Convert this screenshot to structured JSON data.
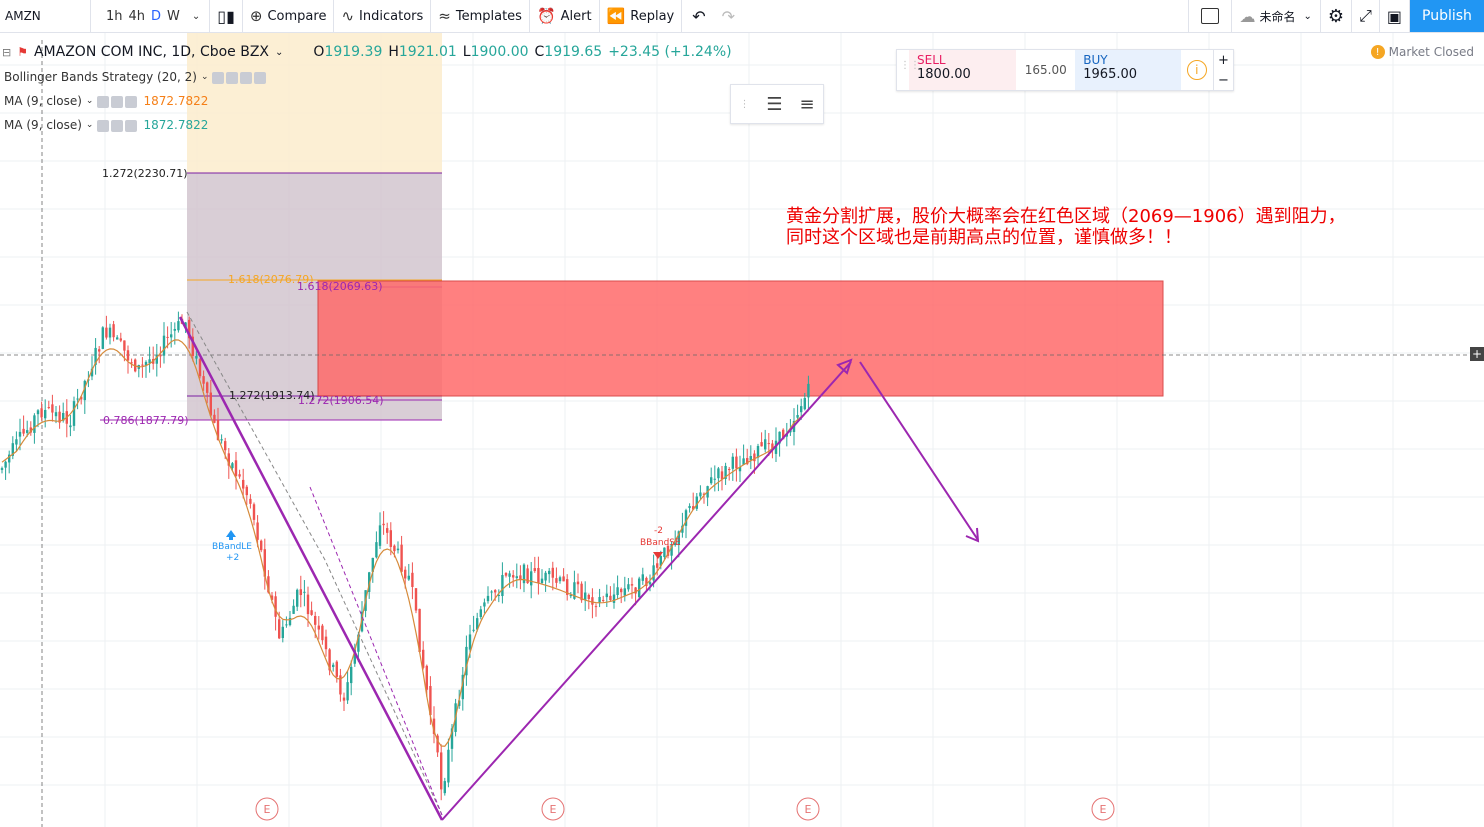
{
  "toolbar": {
    "symbol": "AMZN",
    "intervals": [
      "1h",
      "4h",
      "D",
      "W"
    ],
    "compare": "Compare",
    "indicators": "Indicators",
    "templates": "Templates",
    "alert": "Alert",
    "replay": "Replay",
    "layout_name": "未命名",
    "publish": "Publish"
  },
  "legend": {
    "title": "AMAZON COM INC, 1D, Cboe BZX",
    "o_label": "O",
    "o": "1919.39",
    "h_label": "H",
    "h": "1921.01",
    "l_label": "L",
    "l": "1900.00",
    "c_label": "C",
    "c": "1919.65",
    "change": "+23.45 (+1.24%)"
  },
  "indicators": [
    {
      "name": "Bollinger Bands Strategy (20, 2)",
      "value": "",
      "color": "#333333"
    },
    {
      "name": "MA (9, close)",
      "value": "1872.7822",
      "color": "#f57f17"
    },
    {
      "name": "MA (9, close)",
      "value": "1872.7822",
      "color": "#26a69a"
    }
  ],
  "trade": {
    "sell_label": "SELL",
    "sell": "1800.00",
    "spread": "165.00",
    "buy_label": "BUY",
    "buy": "1965.00",
    "plus": "+",
    "minus": "−"
  },
  "market_status": "Market Closed",
  "fib_labels": {
    "f1272_top": "1.272(2230.71)",
    "f1618_orange": "1.618(2076.79)",
    "f1618_purple": "1.618(2069.63)",
    "f1272_mid": "1.272(1913.74)",
    "f1272_purple": "1.272(1906.54)",
    "f0786": "0.786(1877.79)"
  },
  "signals": {
    "bband_le": "BBandLE",
    "bband_le_qty": "+2",
    "bband_se": "BBandSE",
    "bband_se_qty": "-2"
  },
  "annotation": {
    "line1": "黄金分割扩展，股价大概率会在红色区域（2069—1906）遇到阻力，",
    "line2": "同时这个区域也是前期高点的位置，谨慎做多！！"
  },
  "earnings_marker": "E",
  "colors": {
    "up": "#26a69a",
    "down": "#ef5350",
    "purple": "#9c27b0",
    "resistance_zone": "#ff6b6b",
    "accent": "#2196f3"
  }
}
